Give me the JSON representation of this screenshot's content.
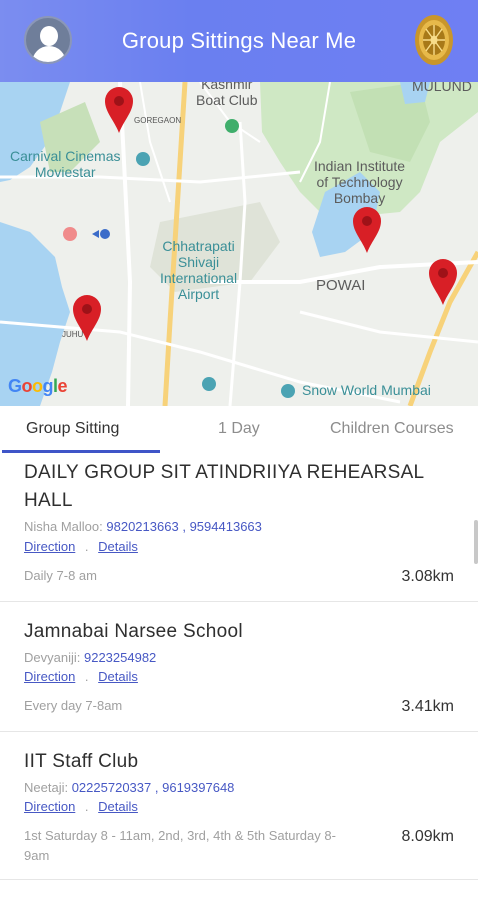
{
  "header": {
    "title": "Group Sittings Near Me",
    "avatar_icon": "user-avatar-icon",
    "right_icon": "dharma-wheel-icon"
  },
  "map": {
    "labels": {
      "kashmir_boat_club": "Kashmir\nBoat Club",
      "goregaon": "GOREGAON",
      "carnival": "Carnival Cinemas\nMoviestar",
      "mulund": "MULUND",
      "iit": "Indian Institute\nof Technology\nBombay",
      "airport": "Chhatrapati\nShivaji\nInternational\nAirport",
      "powai": "POWAI",
      "juhu": "JUHU",
      "snow_world": "Snow World Mumbai",
      "google": "Google"
    },
    "colors": {
      "pin": "#d81f26",
      "water": "#a8d3f2",
      "park": "#cfe8c4",
      "road": "#f7d27a"
    }
  },
  "tabs": [
    {
      "label": "Group Sitting",
      "active": true
    },
    {
      "label": "1 Day",
      "active": false
    },
    {
      "label": "Children Courses",
      "active": false
    }
  ],
  "sittings": [
    {
      "title": "DAILY GROUP SIT ATINDRIIYA REHEARSAL HALL",
      "contact_name": "Nisha Malloo:",
      "phone1": "9820213663",
      "sep": ",",
      "phone2": "9594413663",
      "direction": "Direction",
      "dot": ".",
      "details": "Details",
      "timing": "Daily 7-8 am",
      "distance": "3.08km"
    },
    {
      "title": "Jamnabai Narsee School",
      "contact_name": "Devyaniji:",
      "phone1": "9223254982",
      "direction": "Direction",
      "dot": ".",
      "details": "Details",
      "timing": "Every day 7-8am",
      "distance": "3.41km"
    },
    {
      "title": "IIT Staff Club",
      "contact_name": "Neetaji:",
      "phone1": "02225720337",
      "sep": ",",
      "phone2": "9619397648",
      "direction": "Direction",
      "dot": ".",
      "details": "Details",
      "timing": "1st Saturday 8 - 11am, 2nd, 3rd, 4th & 5th Saturday 8-9am",
      "distance": "8.09km"
    }
  ]
}
